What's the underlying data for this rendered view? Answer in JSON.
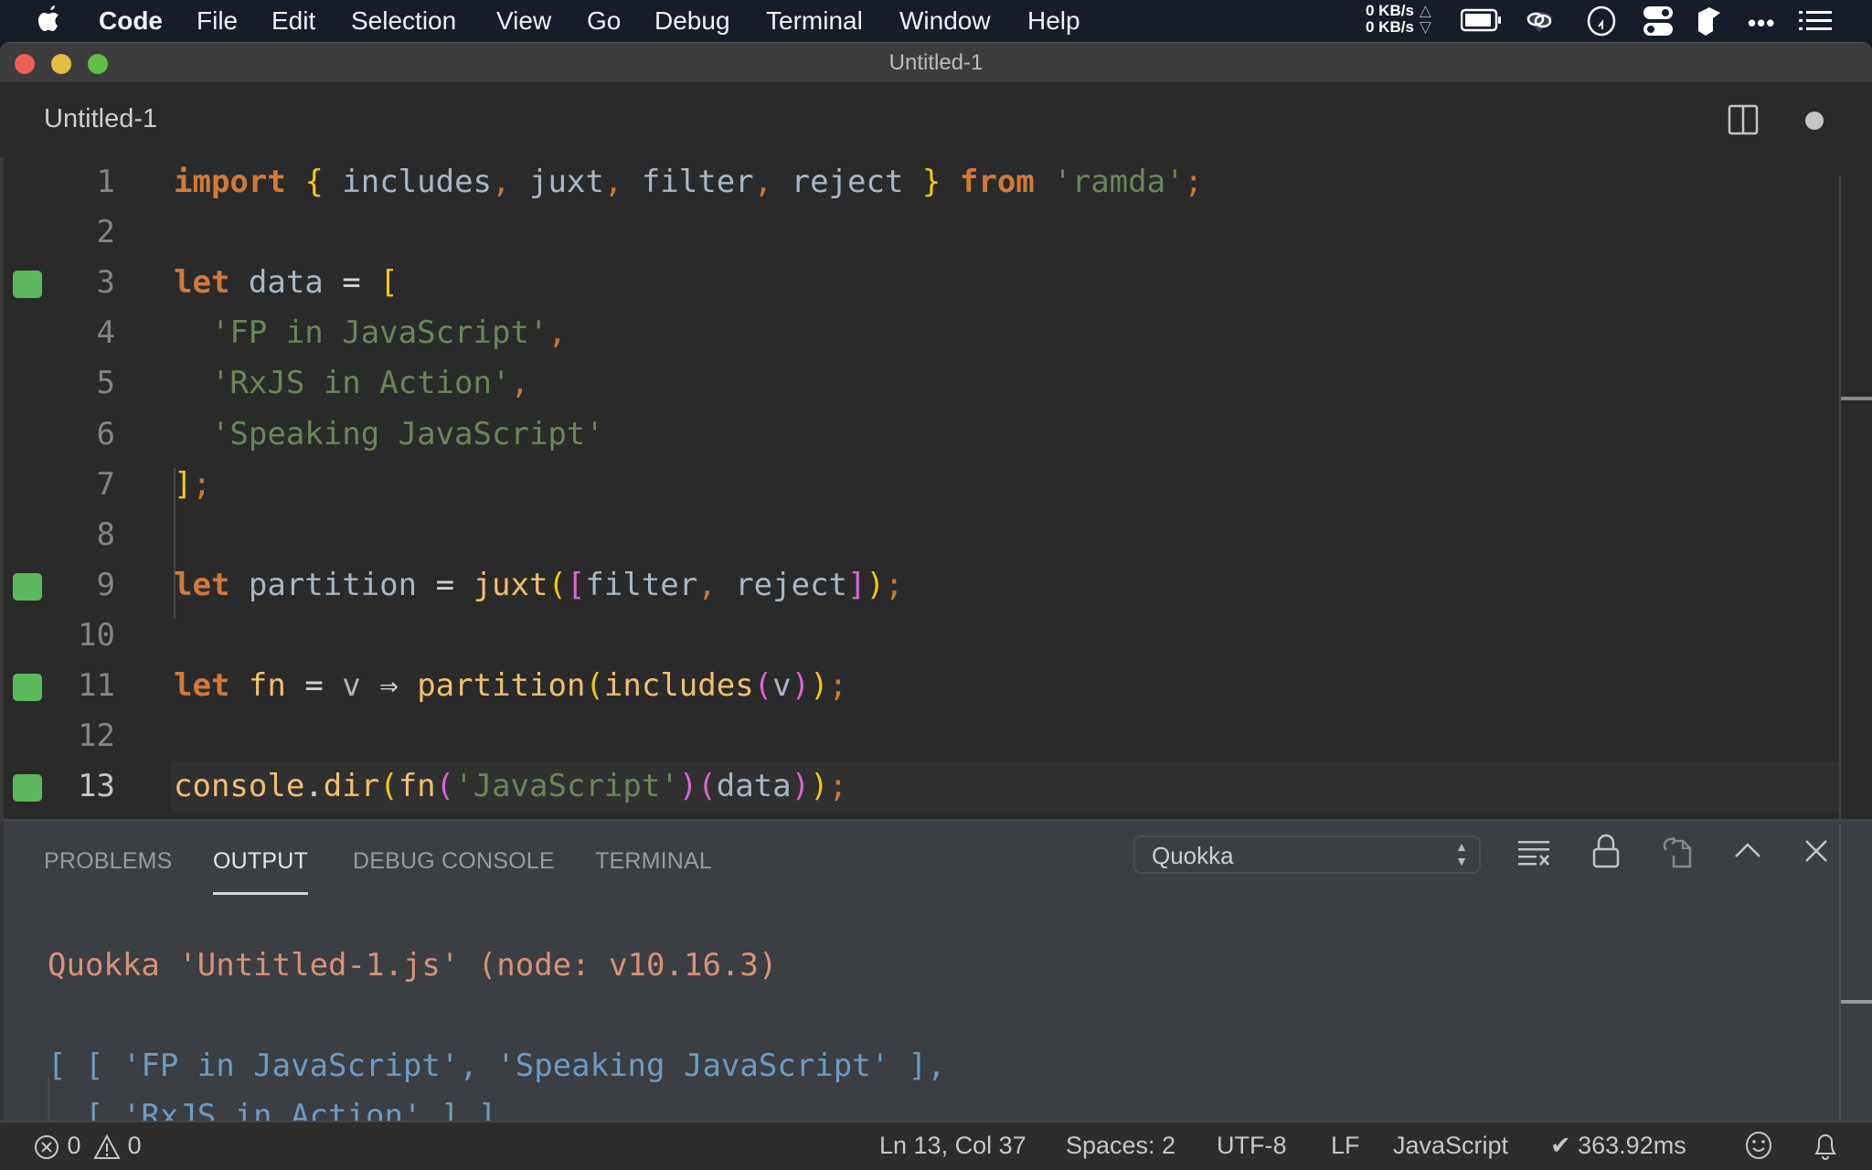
{
  "menubar": {
    "apple_icon": "apple-icon",
    "app_name": "Code",
    "items": [
      "File",
      "Edit",
      "Selection",
      "View",
      "Go",
      "Debug",
      "Terminal",
      "Window",
      "Help"
    ],
    "network": {
      "up": "0 KB/s",
      "down": "0 KB/s"
    },
    "tray_icons": [
      "battery-icon",
      "creative-cloud-icon",
      "clock-icon",
      "control-toggle-icon",
      "bookmark-app-icon",
      "more-icon",
      "list-icon"
    ]
  },
  "window": {
    "title": "Untitled-1"
  },
  "editor": {
    "tab_label": "Untitled-1",
    "split_icon": "split-editor-icon",
    "dirty_icon": "unsaved-dot-icon",
    "lines": [
      {
        "n": "1",
        "marker": false,
        "tokens": [
          [
            "kw",
            "import"
          ],
          [
            "op",
            " "
          ],
          [
            "br1",
            "{"
          ],
          [
            "id",
            " includes"
          ],
          [
            "pun",
            ","
          ],
          [
            "id",
            " juxt"
          ],
          [
            "pun",
            ","
          ],
          [
            "id",
            " filter"
          ],
          [
            "pun",
            ","
          ],
          [
            "id",
            " reject "
          ],
          [
            "br1",
            "}"
          ],
          [
            "op",
            " "
          ],
          [
            "kw",
            "from"
          ],
          [
            "op",
            " "
          ],
          [
            "str",
            "'ramda'"
          ],
          [
            "pun",
            ";"
          ]
        ]
      },
      {
        "n": "2",
        "marker": false,
        "tokens": []
      },
      {
        "n": "3",
        "marker": true,
        "tokens": [
          [
            "kw",
            "let"
          ],
          [
            "id",
            " data "
          ],
          [
            "op",
            "="
          ],
          [
            "op",
            " "
          ],
          [
            "br1",
            "["
          ]
        ]
      },
      {
        "n": "4",
        "marker": false,
        "tokens": [
          [
            "op",
            "  "
          ],
          [
            "str",
            "'FP in JavaScript'"
          ],
          [
            "pun",
            ","
          ]
        ]
      },
      {
        "n": "5",
        "marker": false,
        "tokens": [
          [
            "op",
            "  "
          ],
          [
            "str",
            "'RxJS in Action'"
          ],
          [
            "pun",
            ","
          ]
        ]
      },
      {
        "n": "6",
        "marker": false,
        "tokens": [
          [
            "op",
            "  "
          ],
          [
            "str",
            "'Speaking JavaScript'"
          ]
        ]
      },
      {
        "n": "7",
        "marker": false,
        "tokens": [
          [
            "br1",
            "]"
          ],
          [
            "pun",
            ";"
          ]
        ]
      },
      {
        "n": "8",
        "marker": false,
        "tokens": []
      },
      {
        "n": "9",
        "marker": true,
        "tokens": [
          [
            "kw",
            "let"
          ],
          [
            "id",
            " partition "
          ],
          [
            "op",
            "="
          ],
          [
            "op",
            " "
          ],
          [
            "fnc",
            "juxt"
          ],
          [
            "br1",
            "("
          ],
          [
            "br2",
            "["
          ],
          [
            "id",
            "filter"
          ],
          [
            "pun",
            ","
          ],
          [
            "id",
            " reject"
          ],
          [
            "br2",
            "]"
          ],
          [
            "br1",
            ")"
          ],
          [
            "pun",
            ";"
          ]
        ]
      },
      {
        "n": "10",
        "marker": false,
        "tokens": []
      },
      {
        "n": "11",
        "marker": true,
        "tokens": [
          [
            "kw",
            "let"
          ],
          [
            "op",
            " "
          ],
          [
            "fnc",
            "fn"
          ],
          [
            "op",
            " = "
          ],
          [
            "id",
            "v"
          ],
          [
            "op",
            " ⇒ "
          ],
          [
            "fnc",
            "partition"
          ],
          [
            "br1",
            "("
          ],
          [
            "fnc",
            "includes"
          ],
          [
            "br2",
            "("
          ],
          [
            "id",
            "v"
          ],
          [
            "br2",
            ")"
          ],
          [
            "br1",
            ")"
          ],
          [
            "pun",
            ";"
          ]
        ]
      },
      {
        "n": "12",
        "marker": false,
        "tokens": []
      },
      {
        "n": "13",
        "marker": true,
        "current": true,
        "tokens": [
          [
            "fnc",
            "console"
          ],
          [
            "op",
            "."
          ],
          [
            "fnc",
            "dir"
          ],
          [
            "br1",
            "("
          ],
          [
            "fnc",
            "fn"
          ],
          [
            "br2",
            "("
          ],
          [
            "str",
            "'JavaScript'"
          ],
          [
            "br2",
            ")"
          ],
          [
            "br2",
            "("
          ],
          [
            "id",
            "data"
          ],
          [
            "br2",
            ")"
          ],
          [
            "br1",
            ")"
          ],
          [
            "pun",
            ";"
          ]
        ]
      }
    ]
  },
  "panel": {
    "tabs": [
      {
        "label": "PROBLEMS",
        "active": false
      },
      {
        "label": "OUTPUT",
        "active": true
      },
      {
        "label": "DEBUG CONSOLE",
        "active": false
      },
      {
        "label": "TERMINAL",
        "active": false
      }
    ],
    "channel_select": "Quokka",
    "actions": [
      "clear-output-icon",
      "lock-scroll-icon",
      "open-log-icon",
      "maximize-panel-icon",
      "close-panel-icon"
    ],
    "output_header": "Quokka 'Untitled-1.js' (node: v10.16.3)",
    "output_lines": [
      "[ [ 'FP in JavaScript', 'Speaking JavaScript' ],",
      "  [ 'RxJS in Action' ] ]"
    ]
  },
  "statusbar": {
    "errors": "0",
    "warnings": "0",
    "cursor": "Ln 13, Col 37",
    "spaces": "Spaces: 2",
    "encoding": "UTF-8",
    "eol": "LF",
    "language": "JavaScript",
    "quokka_time": "✔ 363.92ms"
  },
  "colors": {
    "menubar_bg": "#171c2b",
    "editor_bg": "#2a2a2a",
    "panel_bg": "#3b3e42",
    "keyword": "#d2793a",
    "string": "#6a8759",
    "identifier": "#a9b7c6",
    "function": "#f0c070",
    "bracket_1": "#f5c518",
    "bracket_2": "#d966d4",
    "coverage_marker": "#5cb85c",
    "output_header": "#d9927a",
    "output_result": "#6d9bc4"
  }
}
